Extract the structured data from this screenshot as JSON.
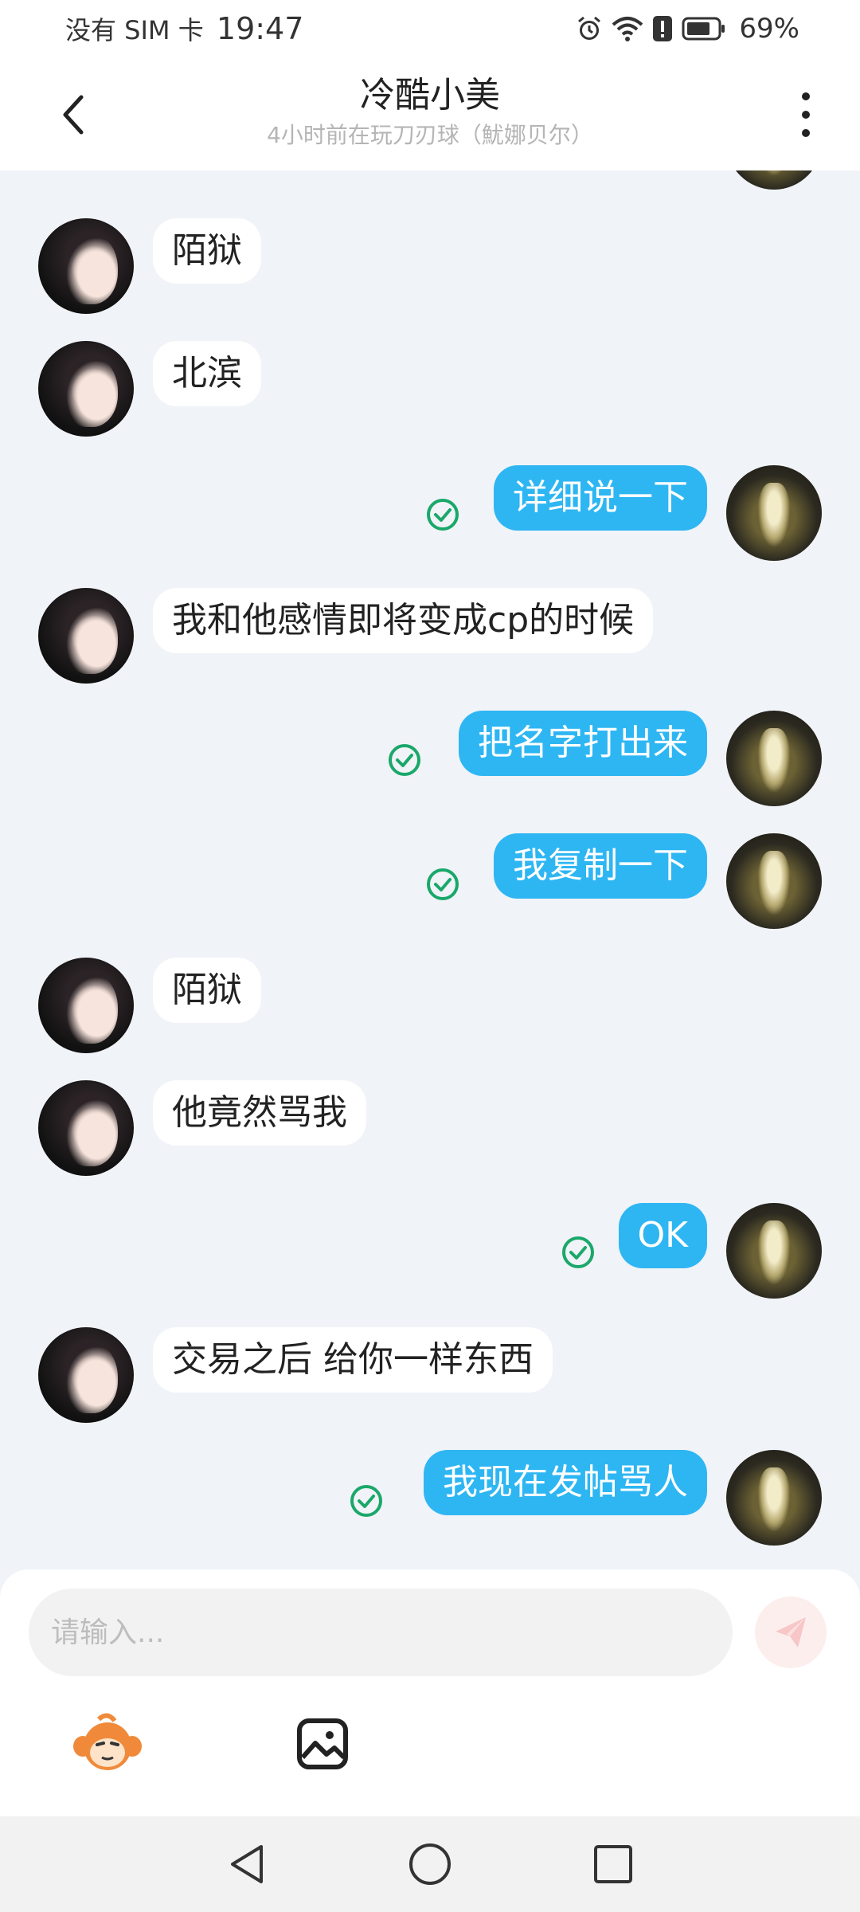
{
  "status_bar": {
    "carrier": "没有 SIM 卡",
    "time": "19:47",
    "battery_percent": "69%",
    "icons": [
      "alarm-icon",
      "wifi-icon",
      "alert-icon",
      "battery-icon"
    ]
  },
  "header": {
    "title": "冷酷小美",
    "subtitle": "4小时前在玩刀刃球（魷娜贝尔）",
    "back_icon": "chevron-left-icon",
    "more_icon": "more-vertical-icon"
  },
  "messages": [
    {
      "side": "in",
      "text": "陌狱"
    },
    {
      "side": "in",
      "text": "北滨"
    },
    {
      "side": "out",
      "text": "详细说一下",
      "status": "sent-check"
    },
    {
      "side": "in",
      "text": "我和他感情即将变成cp的时候"
    },
    {
      "side": "out",
      "text": "把名字打出来",
      "status": "sent-check"
    },
    {
      "side": "out",
      "text": "我复制一下",
      "status": "sent-check"
    },
    {
      "side": "in",
      "text": "陌狱"
    },
    {
      "side": "in",
      "text": "他竟然骂我"
    },
    {
      "side": "out",
      "text": "OK",
      "status": "sent-check"
    },
    {
      "side": "in",
      "text": "交易之后 给你一样东西"
    },
    {
      "side": "out",
      "text": "我现在发帖骂人",
      "status": "sent-check"
    }
  ],
  "composer": {
    "placeholder": "请输入...",
    "send_icon": "send-icon",
    "emoji_icon": "monkey-emoji-icon",
    "image_icon": "image-icon"
  },
  "nav": {
    "icons": [
      "nav-back-icon",
      "nav-home-icon",
      "nav-recent-icon"
    ]
  },
  "colors": {
    "out_bubble": "#2eb6f3",
    "in_bubble": "#ffffff",
    "background": "#f0f3f7",
    "check": "#1aa86a"
  }
}
